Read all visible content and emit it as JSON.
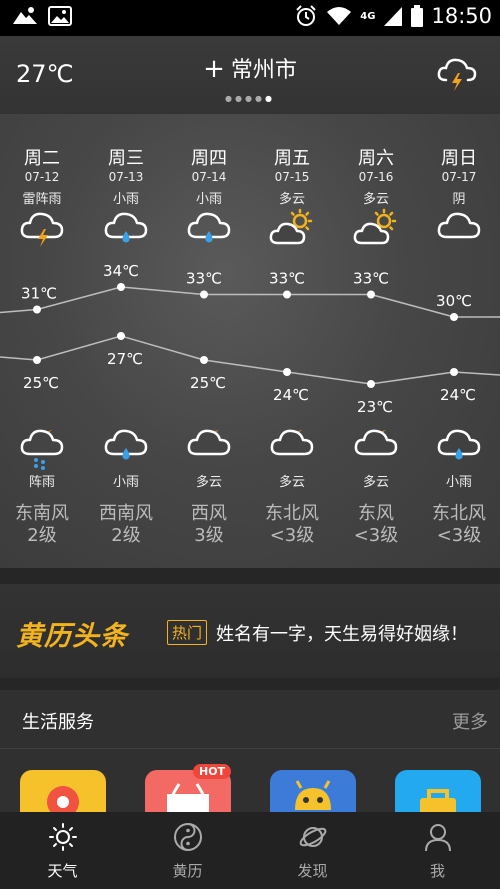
{
  "status_bar": {
    "time": "18:50",
    "network": "4G"
  },
  "header": {
    "current_temp": "27℃",
    "plus": "+",
    "city": "常州市",
    "page_dots": {
      "count": 5,
      "active": 4
    },
    "weather_icon": "thunder-cloud-icon"
  },
  "forecast": {
    "days": [
      {
        "name": "周二",
        "date": "07-12",
        "day_cond": "雷阵雨",
        "day_icon": "thunderstorm-icon",
        "high": "31℃",
        "low": "25℃",
        "night_icon": "night-rain-icon",
        "night_cond": "阵雨",
        "wind_dir": "东南风",
        "wind_level": "2级"
      },
      {
        "name": "周三",
        "date": "07-13",
        "day_cond": "小雨",
        "day_icon": "light-rain-icon",
        "high": "34℃",
        "low": "27℃",
        "night_icon": "light-rain-icon",
        "night_cond": "小雨",
        "wind_dir": "西南风",
        "wind_level": "2级"
      },
      {
        "name": "周四",
        "date": "07-14",
        "day_cond": "小雨",
        "day_icon": "light-rain-icon",
        "high": "33℃",
        "low": "25℃",
        "night_icon": "night-cloudy-icon",
        "night_cond": "多云",
        "wind_dir": "西风",
        "wind_level": "3级"
      },
      {
        "name": "周五",
        "date": "07-15",
        "day_cond": "多云",
        "day_icon": "sun-cloud-icon",
        "high": "33℃",
        "low": "24℃",
        "night_icon": "night-cloudy-icon",
        "night_cond": "多云",
        "wind_dir": "东北风",
        "wind_level": "<3级"
      },
      {
        "name": "周六",
        "date": "07-16",
        "day_cond": "多云",
        "day_icon": "sun-cloud-icon",
        "high": "33℃",
        "low": "23℃",
        "night_icon": "night-cloudy-icon",
        "night_cond": "多云",
        "wind_dir": "东风",
        "wind_level": "<3级"
      },
      {
        "name": "周日",
        "date": "07-17",
        "day_cond": "阴",
        "day_icon": "cloud-icon",
        "high": "30℃",
        "low": "24℃",
        "night_icon": "light-rain-icon",
        "night_cond": "小雨",
        "wind_dir": "东北风",
        "wind_level": "<3级"
      }
    ],
    "high_values": [
      31,
      34,
      33,
      33,
      33,
      30
    ],
    "low_values": [
      25,
      27,
      25,
      24,
      23,
      24
    ]
  },
  "headline": {
    "logo": "黄历头条",
    "tag": "热门",
    "text": "姓名有一字，天生易得好姻缘！"
  },
  "life_services": {
    "title": "生活服务",
    "more": "更多",
    "hot_badge": "HOT",
    "tiles": [
      {
        "icon": "location-pin-icon",
        "color": "#f6c22c"
      },
      {
        "icon": "basket-icon",
        "color": "#f36a64"
      },
      {
        "icon": "android-robot-icon",
        "color": "#3d7bd9"
      },
      {
        "icon": "bag-icon",
        "color": "#23a9ef"
      }
    ]
  },
  "bottom_nav": [
    {
      "label": "天气",
      "icon": "sun-icon",
      "active": true
    },
    {
      "label": "黄历",
      "icon": "yin-yang-icon",
      "active": false
    },
    {
      "label": "发现",
      "icon": "planet-icon",
      "active": false
    },
    {
      "label": "我",
      "icon": "person-icon",
      "active": false
    }
  ],
  "colors": {
    "accent": "#f3b31c",
    "thunder": "#f3a31c",
    "rain": "#3aa0e8"
  }
}
